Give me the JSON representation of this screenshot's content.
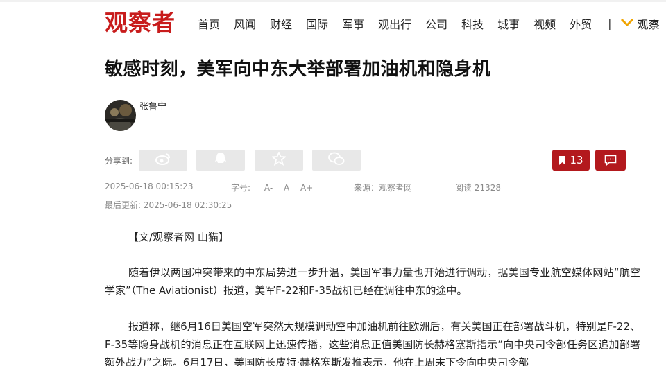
{
  "site": {
    "logo": "观察者",
    "nav": [
      "首页",
      "风闻",
      "财经",
      "国际",
      "军事",
      "观出行",
      "公司",
      "科技",
      "城事",
      "视频",
      "外贸"
    ],
    "nav_separator": "|",
    "nav_more": "观察"
  },
  "article": {
    "title": "敏感时刻，美军向中东大举部署加油机和隐身机",
    "author": "张鲁宁",
    "share_label": "分享到:",
    "share_icons": [
      "weibo-icon",
      "qq-icon",
      "qzone-icon",
      "wechat-icon"
    ],
    "bookmark_count": "13",
    "published": "2025-06-18 00:15:23",
    "font_size_label": "字号:",
    "font_sizes": [
      "A-",
      "A",
      "A+"
    ],
    "source": "来源：观察者网",
    "reads": "阅读 21328",
    "updated": "最后更新: 2025-06-18 02:30:25",
    "paragraphs": [
      "【文/观察者网 山猫】",
      "随着伊以两国冲突带来的中东局势进一步升温，美国军事力量也开始进行调动，据美国专业航空媒体网站“航空学家”（The Aviationist）报道，美军F-22和F-35战机已经在调往中东的途中。",
      "报道称，继6月16日美国空军突然大规模调动空中加油机前往欧洲后，有关美国正在部署战斗机，特别是F-22、F-35等隐身战机的消息正在互联网上迅速传播，这些消息正值美国防长赫格塞斯指示“向中央司令部任务区追加部署额外战力”之际。6月17日，美国防长皮特·赫格塞斯发推表示，他在上周末下令向中央司令部"
    ]
  },
  "colors": {
    "brand": "#c81c1c",
    "action": "#b3191d",
    "meta": "#8a8a8a",
    "share_bg": "#e8e8e8"
  }
}
